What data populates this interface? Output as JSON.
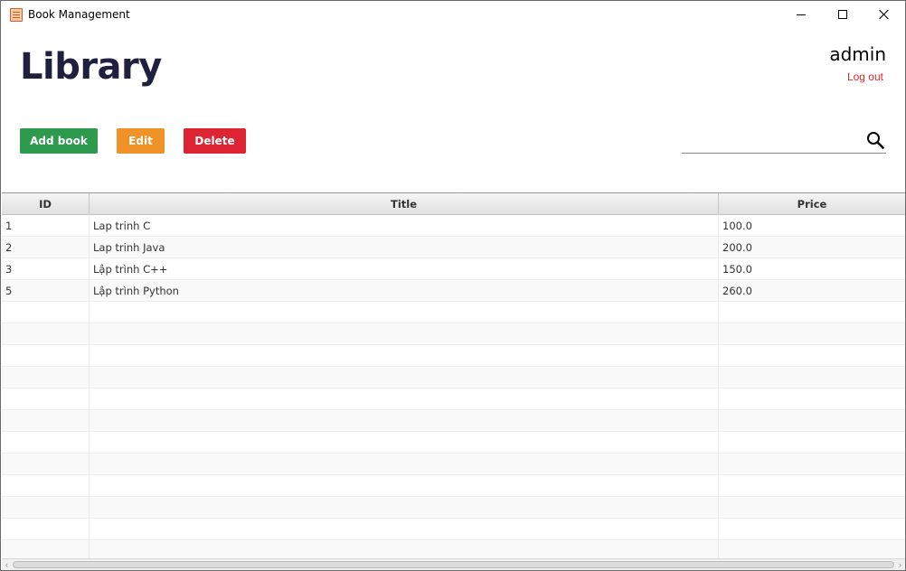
{
  "window": {
    "title": "Book Management"
  },
  "header": {
    "title": "Library",
    "username": "admin",
    "logout_label": "Log out"
  },
  "toolbar": {
    "add_label": "Add book",
    "edit_label": "Edit",
    "delete_label": "Delete"
  },
  "search": {
    "value": "",
    "placeholder": ""
  },
  "table": {
    "columns": [
      "ID",
      "Title",
      "Price"
    ],
    "rows": [
      {
        "id": "1",
        "title": "Lap trinh C",
        "price": "100.0"
      },
      {
        "id": "2",
        "title": "Lap trinh Java",
        "price": "200.0"
      },
      {
        "id": "3",
        "title": "Lập trình C++",
        "price": "150.0"
      },
      {
        "id": "5",
        "title": "Lập trình Python",
        "price": "260.0"
      }
    ]
  },
  "colors": {
    "add": "#2e9a4e",
    "edit": "#ef9228",
    "delete": "#dc2433",
    "logout": "#e0262f",
    "title": "#1f1f3f"
  },
  "icons": {
    "app": "book-icon",
    "search": "search-icon",
    "minimize": "minimize-icon",
    "maximize": "maximize-icon",
    "close": "close-icon"
  }
}
